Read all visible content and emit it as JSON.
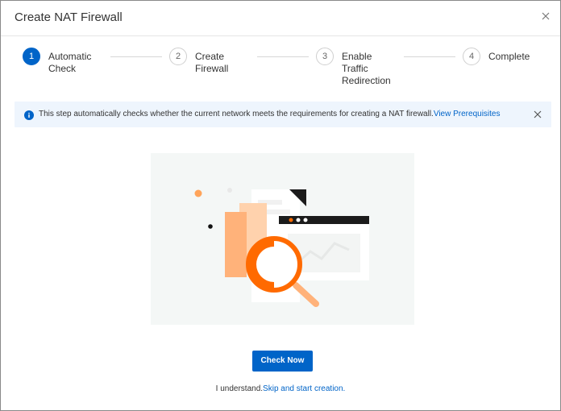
{
  "dialog": {
    "title": "Create NAT Firewall"
  },
  "steps": [
    {
      "number": "1",
      "label": "Automatic\nCheck",
      "active": true
    },
    {
      "number": "2",
      "label": "Create\nFirewall",
      "active": false
    },
    {
      "number": "3",
      "label": "Enable\nTraffic\nRedirection",
      "active": false
    },
    {
      "number": "4",
      "label": "Complete",
      "active": false
    }
  ],
  "banner": {
    "text": "This step automatically checks whether the current network meets the requirements for creating a NAT firewall.",
    "link": "View Prerequisites"
  },
  "actions": {
    "check_now": "Check Now",
    "skip_prefix": "I understand.",
    "skip_link": "Skip and start creation."
  },
  "colors": {
    "primary": "#0064c8",
    "banner_bg": "#eef5fd",
    "illustration_orange": "#ff6a00"
  }
}
